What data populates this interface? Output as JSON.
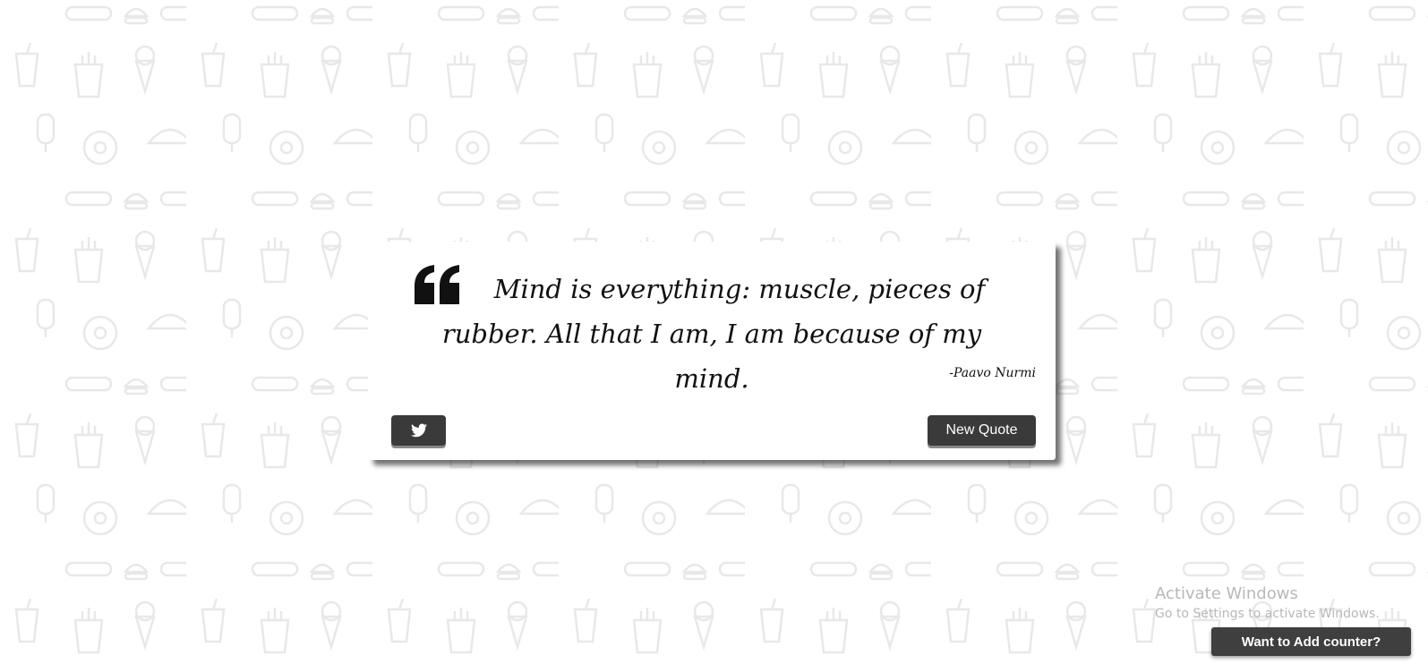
{
  "quote": {
    "text": "Mind is everything: muscle, pieces of rubber. All that I am, I am because of my mind.",
    "author": "-Paavo Nurmi"
  },
  "actions": {
    "tweet_icon": "twitter-icon",
    "new_quote_label": "New Quote"
  },
  "windows_notice": {
    "title": "Activate Windows",
    "subtitle": "Go to Settings to activate Windows."
  },
  "counter_button": {
    "label": "Want to Add counter?"
  },
  "colors": {
    "button_bg": "#3a3a3a",
    "pattern": "#ececec"
  }
}
